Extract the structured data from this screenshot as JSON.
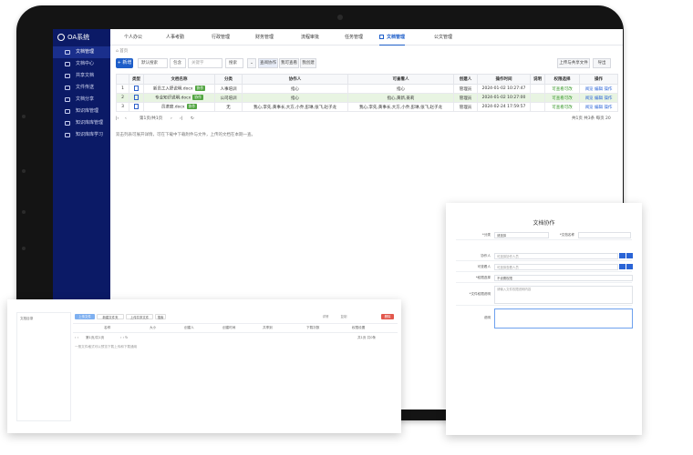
{
  "app": {
    "title": "OA系统"
  },
  "topnav": [
    "个人办公",
    "人事考勤",
    "行政管理",
    "财务管理",
    "流程审批",
    "任务管理",
    "文档管理",
    "公文管理"
  ],
  "sidebar": [
    "文档管理",
    "文档中心",
    "共享文档",
    "文件传送",
    "文档分享",
    "知识库管理",
    "知识库库管理",
    "知识库库学习"
  ],
  "breadcrumb": "首页",
  "toolbar": {
    "new_label": "+ 新增",
    "filter1": "默认搜索",
    "filter2": "包含",
    "keyword_placeholder": "关键字",
    "search_label": "搜索",
    "tab1": "查阅协作",
    "tab2": "我可查看",
    "tab3": "我创建",
    "upload_label": "上传与共享文件",
    "more_label": "导出"
  },
  "table": {
    "headers": [
      "",
      "类型",
      "文档名称",
      "分类",
      "协作人",
      "可查看人",
      "创建人",
      "操作时间",
      "说明",
      "权限选择",
      "操作"
    ],
    "rows": [
      {
        "no": "1",
        "name": "新员工入职说明.docx",
        "badge": "协作",
        "category": "人事培训",
        "collab": "指心",
        "viewer": "指心",
        "creator": "管理员",
        "time": "2024-01-02 10:27:47",
        "perm": "可查看可改",
        "actions": "阅览 编辑",
        "op": "操作"
      },
      {
        "no": "2",
        "name": "专业知识说明.docx",
        "badge": "协作",
        "category": "公司培训",
        "collab": "指心",
        "viewer": "指心,黄新,姜莉",
        "creator": "管理员",
        "time": "2024-01-02 10:27:00",
        "perm": "可查看可改",
        "actions": "阅览 编辑",
        "op": "操作"
      },
      {
        "no": "3",
        "name": "员进度.docx",
        "badge": "协作",
        "category": "无",
        "collab": "我心,李先,黄事长,大方,小乔,彭琳,张飞,赵子龙",
        "viewer": "我心,李先,黄事长,大方,小乔,彭琳,张飞,赵子龙",
        "creator": "管理员",
        "time": "2024-02-24 17:59:57",
        "perm": "可查看可改",
        "actions": "阅览 编辑",
        "op": "操作"
      }
    ]
  },
  "pager": {
    "page_text": "第1页/共1页",
    "summary": "共1页 共3条  每页 20"
  },
  "note": "双击列表可展开详情，可在下载中下载附件与文件，上传的文档在本期一查。",
  "left_card": {
    "left_col": "文档目录",
    "upload": "上传文件",
    "new_folder": "新建文件夹",
    "more": "上传共享文件",
    "search": "搜索",
    "op1": "详情",
    "op2": "复制",
    "op3": "删除",
    "headers": [
      "名称",
      "大小",
      "创建人",
      "创建时间",
      "共享到",
      "下载次数",
      "权限设置"
    ],
    "pager": "第1页/共1页",
    "summary": "共1页 共0条",
    "empty_note": "一般文件格式可以预览下载上传和下载通用"
  },
  "right_card": {
    "title": "文档协作",
    "fields": [
      {
        "label": "*分类",
        "value": "请选择"
      },
      {
        "label": "*文档名称",
        "value": ""
      },
      {
        "label": "协作人",
        "value": "可选择协作人员"
      },
      {
        "label": "可查看人",
        "value": "可选择查看人员"
      },
      {
        "label": "*权限选择",
        "value": "不设置权限"
      },
      {
        "label": "*文件权限说明",
        "value": "请输入文件权限说明内容"
      },
      {
        "label": "说明",
        "value": ""
      }
    ],
    "extra_label": "上传"
  },
  "colors": {
    "sidebar": "#0b1a66",
    "accent": "#1d5ec9",
    "badge": "#52a542"
  }
}
